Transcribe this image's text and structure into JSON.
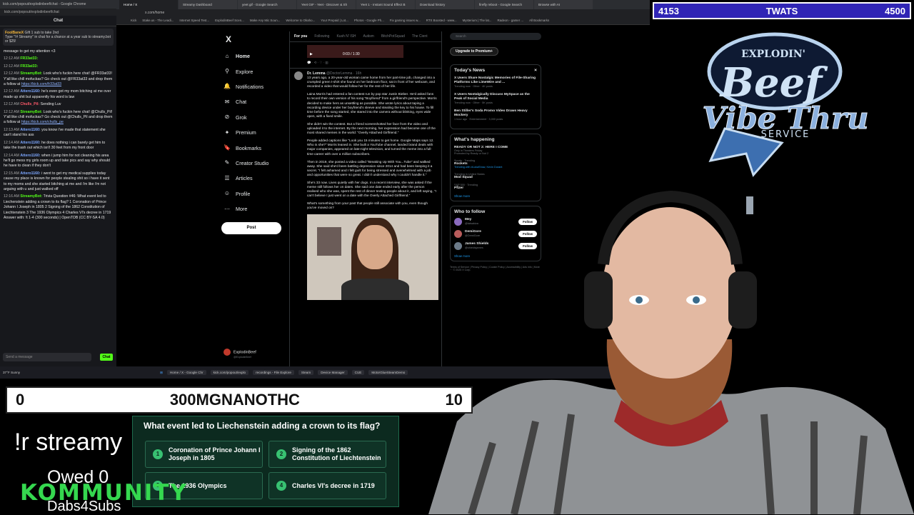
{
  "chat": {
    "window_title": "kick.com/popout/explodinbeef/chat - Google Chrome",
    "url": "kick.com/popout/explodinbeef/chat",
    "title": "Chat",
    "pinned_user": "FoolBaneX",
    "pinned_text": "Gift 1 sub to take 2nd",
    "pinned_msg": "Type \"!# Streamy\" in chat for a chance at a year sub to streamy.bot or $25!",
    "messages": [
      {
        "time": "",
        "user": "",
        "text": "message to get my attention <3",
        "link": ""
      },
      {
        "time": "12:12 AM",
        "user": "FR33at33:",
        "text": "",
        "link": ""
      },
      {
        "time": "12:12 AM",
        "user": "FR33at33:",
        "text": "",
        "link": ""
      },
      {
        "time": "12:12 AM",
        "user": "StreamyBot:",
        "text": "Look who's fuckin here chat! @FR33at33! Y'all like chill mofuckas? Go check out @FR33at33 and drop them a follow at",
        "link": "https://kick.com/fr33at33"
      },
      {
        "time": "12:12 AM",
        "user": "Attero1160:",
        "text": "he's even got my mom bitching at me over made up shit but apparently his word is law",
        "link": ""
      },
      {
        "time": "12:12 AM",
        "user": "Chulls_Pil:",
        "text": "Sending Luv",
        "link": ""
      },
      {
        "time": "12:12 AM",
        "user": "StreamyBot:",
        "text": "Look who's fuckin here chat! @Chulls_Pil! Y'all like chill mofuckas? Go check out @Chulls_Pil and drop them a follow at",
        "link": "https://kick.com/chulls_pe"
      },
      {
        "time": "12:13 AM",
        "user": "Attero1160:",
        "text": "you know i've made that statement she can't stand his ass",
        "link": ""
      },
      {
        "time": "12:14 AM",
        "user": "Attero1160:",
        "text": "he does nothing i can barely get him to take the trash out which isn't 30 feet from my front door",
        "link": ""
      },
      {
        "time": "12:14 AM",
        "user": "Attero1160:",
        "text": "when i jump him for not cleaning his area he'll go mess my girls room up and take pics and say why should he have to clean if they don't",
        "link": ""
      },
      {
        "time": "12:15 AM",
        "user": "Attero1160:",
        "text": "i went to get my medical supplies today cause my place is known for people stealing shit so i have it sent to my moms and she started bitching at me and i'm like i'm not arguing with u and just walked off",
        "link": ""
      },
      {
        "time": "12:16 AM",
        "user": "StreamyBot:",
        "text": "Trivia Question #46: What event led to Liechenstein adding a crown to its flag? 1 Coronation of Prince Johann I Joseph in 1805 2 Signing of the 1862 Constitution of Liechtenstein 3 The 1936 Olympics 4 Charles VI's decree in 1719 Answer with: !t 1-4 (300 seconds) | OpenTDB (CC BY-SA 4.0)",
        "link": ""
      }
    ],
    "input_placeholder": "Send a message",
    "send_label": "Chat"
  },
  "browser": {
    "tabs": [
      "Home / X",
      "Streamy Dashboard",
      "yeet gif - Google Search",
      "Yeet GIF - Yeet - Discover & Sh",
      "Yeet 1 - Instant Sound Effect B",
      "Download history",
      "firefly reboot - Google Search",
      "Browse with AI"
    ],
    "address": "x.com/home",
    "bookmarks": [
      "Kick",
      "Stake.us - The Leadi...",
      "Internet Speed Test...",
      "ExplodinBeef Scen...",
      "Make Any Mic Soun...",
      "Welcome to Okaho...",
      "Your Prepaid | Lot...",
      "Photos - Google Ph...",
      "Fix gaming issues w...",
      "RTX Boosted - www...",
      "Mysterium | The lat...",
      "Radeon - gamer ...",
      "All Bookmarks"
    ]
  },
  "x": {
    "logo": "X",
    "nav": [
      {
        "icon": "home-icon",
        "glyph": "⌂",
        "label": "Home"
      },
      {
        "icon": "search-icon",
        "glyph": "⚲",
        "label": "Explore"
      },
      {
        "icon": "bell-icon",
        "glyph": "🔔",
        "label": "Notifications"
      },
      {
        "icon": "chat-icon",
        "glyph": "✉",
        "label": "Chat"
      },
      {
        "icon": "grok-icon",
        "glyph": "⊘",
        "label": "Grok"
      },
      {
        "icon": "premium-icon",
        "glyph": "✦",
        "label": "Premium"
      },
      {
        "icon": "bookmark-icon",
        "glyph": "🔖",
        "label": "Bookmarks"
      },
      {
        "icon": "studio-icon",
        "glyph": "✎",
        "label": "Creator Studio"
      },
      {
        "icon": "articles-icon",
        "glyph": "☰",
        "label": "Articles"
      },
      {
        "icon": "profile-icon",
        "glyph": "☺",
        "label": "Profile"
      },
      {
        "icon": "more-icon",
        "glyph": "⋯",
        "label": "More"
      }
    ],
    "post_button": "Post",
    "account_name": "ExplodinBeef",
    "account_handle": "@ExplodinBeef",
    "feed_tabs": [
      "For you",
      "Following",
      "Kush N' ISH",
      "Autism",
      "BitchPotSquad",
      "The Cient"
    ],
    "video_time": "0:03 / 1:30",
    "tweet_author": "Dr. Lemma",
    "tweet_handle": "@DoctorLemma · 16h",
    "tweet_paragraphs": [
      "13 years ago, a 20-year-old woman came home from her part-time job, changed into a crumpled green t-shirt she found on her bedroom floor, sat in front of her webcam, and recorded a video that would follow her for the rest of her life.",
      "Laina Morris had entered a fan contest run by pop star Justin Bieber. He'd asked fans to record their own version of his song \"Boyfriend\" from a girlfriend's perspective. Morris decided to make hers as unsettling as possible. She wrote lyrics about taping a recording device under her boyfriend's sleeve and stealing the key to his house. To fill time before the song started, she stared into the camera without blinking, eyes wide open, with a fixed smile.",
      "She didn't win the contest. But a friend screenshotted her face from the video and uploaded it to the internet. By the next morning, her expression had become one of the most shared memes in the world: \"Overly Attached Girlfriend.\"",
      "People added captions like \"Look you 15 minutes to get home. Google Maps says 12. Who is she?\" Morris leaned in. She built a YouTube channel, landed brand deals with major companies, appeared on late-night television, and turned the meme into a full-time career with over a million subscribers.",
      "Then in 2019, she posted a video called \"Breaking Up With You...Tube\" and walked away. She said she'd been battling depression since 2014 and had been keeping it a secret. \"I felt ashamed and I felt guilt for being stressed and overwhelmed with a job and opportunities that were so great. I didn't understand why I couldn't handle it.\"",
      "She's 33 now. Lives quietly with her dogs. In a recent interview, she was asked if the meme still follows her on dates. She said one date ended early after the person realised who she was, spent the rest of dinner texting people about it, and left saying, \"I can't believe I just went on a date with the Overly Attached Girlfriend.\"",
      "What's something from your past that people still associate with you, even though you've moved on?"
    ],
    "search_placeholder": "Search",
    "upgrade_label": "Upgrade to Premium+",
    "news_title": "Today's News",
    "news": [
      {
        "t": "X Users Share Nostalgic Memories of File-Sharing Platforms Like LimeWire and ...",
        "m": "Trending now · Other · 4K posts"
      },
      {
        "t": "X Users Nostalgically Discuss MySpace as the Peak of Social Media",
        "m": "Trending now · Other · 5K posts"
      },
      {
        "t": "Ben Stiller's Soda Promo Video Draws Heavy Mockery",
        "m": "1 hour ago · Entertainment · 3,000 posts"
      }
    ],
    "happening_title": "What's happening",
    "trends": [
      {
        "c": "Only in Theaters Friday",
        "t": "READY OR NOT 2: HERE I COME",
        "m": "Promoted by Ready or Not 2"
      },
      {
        "c": "Sports · Trending",
        "t": "Rockets",
        "m": "Trending with #LukaShow, Kevin Durant"
      },
      {
        "c": "Trending in United States",
        "t": "Mod Squad",
        "m": ""
      },
      {
        "c": "S&P 500 · Trending",
        "t": "Pfizer",
        "m": ""
      }
    ],
    "show_more": "Show more",
    "follow_title": "Who to follow",
    "follows": [
      {
        "name": "Mey",
        "handle": "@tatsakiza",
        "btn": "Follow"
      },
      {
        "name": "DemiGore",
        "handle": "@DemiGore",
        "btn": "Follow"
      },
      {
        "name": "James Shields",
        "handle": "@shieldsjames",
        "btn": "Follow"
      }
    ],
    "footer": "Terms of Service | Privacy Policy | Cookie Policy | Accessibility | Ads info | More ··· © 2025 X Corp."
  },
  "taskbar": {
    "weather": "37°F Sunny",
    "items": [
      "Home / X - Google Chr",
      "kick.com/popout/explo",
      "recordings - File Explore",
      "Steam",
      "Device Manager",
      "CUE",
      "MotorGlueSteamDemo"
    ]
  },
  "overlay": {
    "score_left": "4153",
    "score_mid": "TWATS",
    "score_right": "4500",
    "logo_top": "EXPLODIN'",
    "logo_main": "Beef",
    "logo_sub": "Vibe Thru",
    "logo_service": "SERVICE",
    "trivia_left": "0",
    "trivia_title": "300MGNANOTHC",
    "trivia_right": "10",
    "question": "What event led to Liechenstein adding a crown to its flag?",
    "answers": [
      {
        "n": "1",
        "t": "Coronation of Prince Johann I Joseph in 1805"
      },
      {
        "n": "2",
        "t": "Signing of the 1862 Constitution of Liechtenstein"
      },
      {
        "n": "3",
        "t": "The 1936 Olympics"
      },
      {
        "n": "4",
        "t": "Charles VI's decree in 1719"
      }
    ],
    "streamy": "!r streamy",
    "owed": "Owed 0",
    "kommunity": "KOMMUNITY",
    "dabs": "Dabs4Subs"
  },
  "colors": {
    "kick_green": "#53fc18",
    "scorebar_bg": "#3025b5",
    "trivia_panel": "#0c2a1f",
    "x_blue": "#1d9bf0"
  }
}
